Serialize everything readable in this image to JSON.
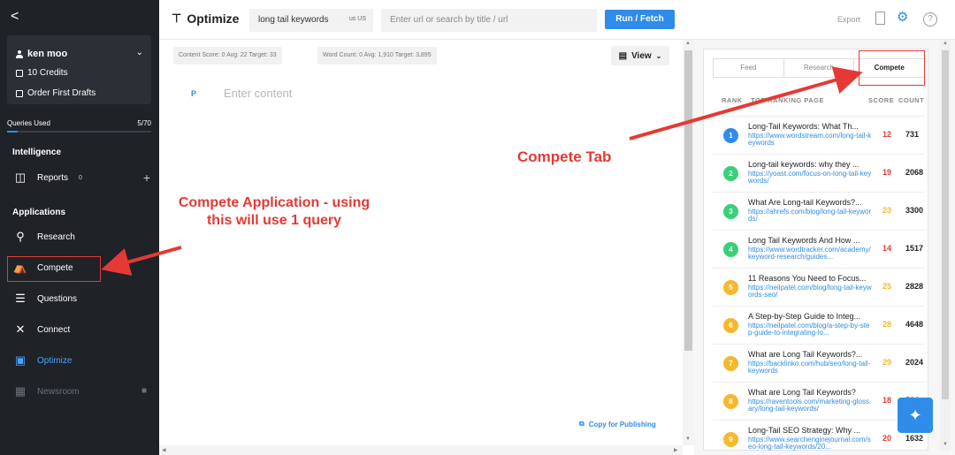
{
  "sidebar": {
    "back_label": "<",
    "account": {
      "name": "ken moo",
      "credits": "10 Credits",
      "drafts": "Order First Drafts"
    },
    "queries": {
      "label": "Queries Used",
      "value": "5/70",
      "fraction": 0.071
    },
    "intelligence_title": "Intelligence",
    "reports": {
      "label": "Reports",
      "count": "0",
      "add": "+"
    },
    "applications_title": "Applications",
    "items": [
      {
        "label": "Research",
        "icon": "research-icon"
      },
      {
        "label": "Compete",
        "icon": "trophy-icon"
      },
      {
        "label": "Questions",
        "icon": "questions-icon"
      },
      {
        "label": "Connect",
        "icon": "connect-icon"
      },
      {
        "label": "Optimize",
        "icon": "optimize-icon"
      },
      {
        "label": "Newsroom",
        "icon": "newsroom-icon"
      }
    ]
  },
  "topbar": {
    "title": "Optimize",
    "keyword": "long tail keywords",
    "locale": "us US",
    "url_placeholder": "Enter url or search by title / url",
    "run_label": "Run / Fetch",
    "export_label": "Export"
  },
  "editor": {
    "content_score": "Content Score: 0  Avg: 22  Target: 33",
    "word_count": "Word Count: 0  Avg: 1,910  Target: 3,895",
    "view_label": "View",
    "paragraph_marker": "P",
    "placeholder": "Enter content",
    "copy_label": "Copy for Publishing"
  },
  "panel": {
    "tabs": [
      "Feed",
      "Research",
      "Compete"
    ],
    "active_tab": "Compete",
    "headers": {
      "rank": "RANK",
      "page": "TOP RANKING PAGE",
      "score": "SCORE",
      "count": "COUNT"
    },
    "rows": [
      {
        "rank": "1",
        "title": "Long-Tail Keywords: What Th...",
        "url": "https://www.wordstream.com/long-tail-keywords",
        "score": "12",
        "count": "731",
        "rank_color": "#2f8ce8",
        "score_color": "#e53935"
      },
      {
        "rank": "2",
        "title": "Long-tail keywords: why they ...",
        "url": "https://yoast.com/focus-on-long-tail-keywords/",
        "score": "19",
        "count": "2068",
        "rank_color": "#3ccf7a",
        "score_color": "#e53935"
      },
      {
        "rank": "3",
        "title": "What Are Long-tail Keywords?...",
        "url": "https://ahrefs.com/blog/long-tail-keywords/",
        "score": "23",
        "count": "3300",
        "rank_color": "#3ccf7a",
        "score_color": "#f5b82e"
      },
      {
        "rank": "4",
        "title": "Long Tail Keywords And How ...",
        "url": "https://www.wordtracker.com/academy/keyword-research/guides...",
        "score": "14",
        "count": "1517",
        "rank_color": "#3ccf7a",
        "score_color": "#e53935"
      },
      {
        "rank": "5",
        "title": "11 Reasons You Need to Focus...",
        "url": "https://neilpatel.com/blog/long-tail-keywords-seo/",
        "score": "25",
        "count": "2828",
        "rank_color": "#f5b82e",
        "score_color": "#f5b82e"
      },
      {
        "rank": "6",
        "title": "A Step-by-Step Guide to Integ...",
        "url": "https://neilpatel.com/blog/a-step-by-step-guide-to-integrating-lo...",
        "score": "28",
        "count": "4648",
        "rank_color": "#f5b82e",
        "score_color": "#f5b82e"
      },
      {
        "rank": "7",
        "title": "What are Long Tail Keywords?...",
        "url": "https://backlinko.com/hub/seo/long-tail-keywords",
        "score": "29",
        "count": "2024",
        "rank_color": "#f5b82e",
        "score_color": "#f5b82e"
      },
      {
        "rank": "8",
        "title": "What are Long Tail Keywords?",
        "url": "https://raventools.com/marketing-glossary/long-tail-keywords/",
        "score": "18",
        "count": "534",
        "rank_color": "#f5b82e",
        "score_color": "#e53935"
      },
      {
        "rank": "9",
        "title": "Long-Tail SEO Strategy: Why ...",
        "url": "https://www.searchenginejournal.com/seo-long-tail-keywords/20...",
        "score": "20",
        "count": "1632",
        "rank_color": "#f5b82e",
        "score_color": "#e53935"
      }
    ]
  },
  "annotations": {
    "compete_app": "Compete Application - using this will use 1 query",
    "compete_tab": "Compete Tab"
  },
  "colors": {
    "accent": "#2f8ce8",
    "annotation": "#e53935",
    "sidebar_bg": "#1f2328"
  }
}
